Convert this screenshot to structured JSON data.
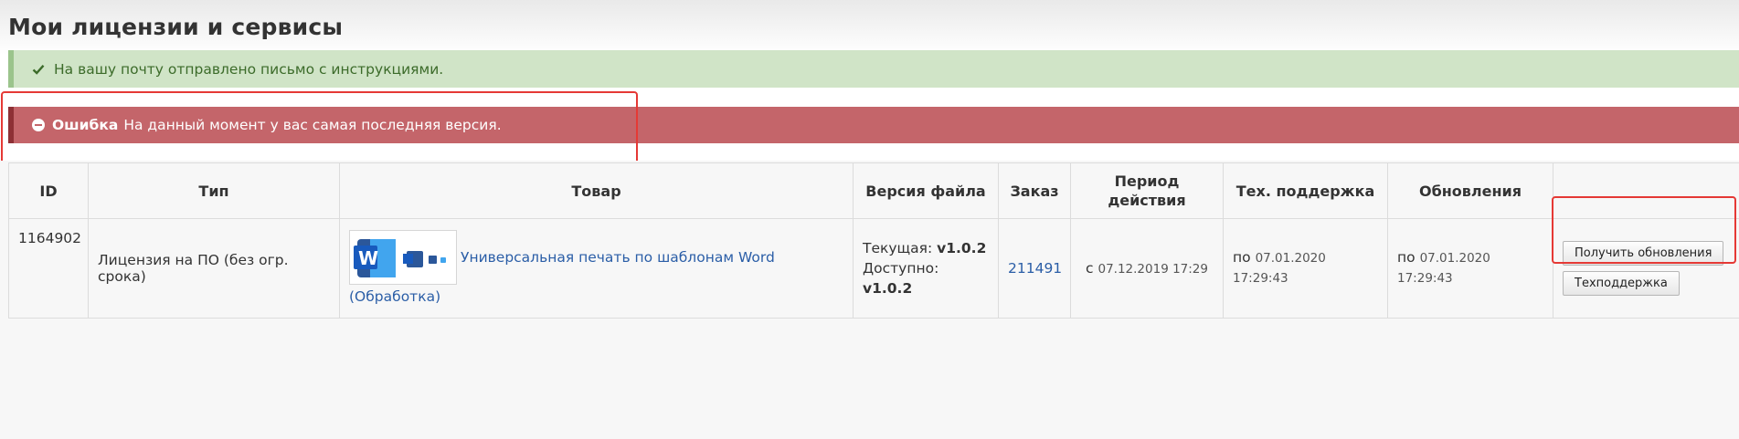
{
  "page": {
    "title": "Мои лицензии и сервисы"
  },
  "alerts": {
    "success": {
      "text": "На вашу почту отправлено письмо с инструкциями."
    },
    "error": {
      "label": "Ошибка",
      "text": "На данный момент у вас самая последняя версия."
    }
  },
  "table": {
    "headers": {
      "id": "ID",
      "type": "Тип",
      "product": "Товар",
      "file_version": "Версия файла",
      "order": "Заказ",
      "period_line1": "Период",
      "period_line2": "действия",
      "support": "Тех. поддержка",
      "updates": "Обновления"
    },
    "row": {
      "id": "1164902",
      "type": "Лицензия на ПО (без огр. срока)",
      "product_name": "Универсальная печать по шаблонам Word",
      "product_note": "(Обработка)",
      "current_label": "Текущая:",
      "current_version": "v1.0.2",
      "available_label": "Доступно:",
      "available_version": "v1.0.2",
      "order": "211491",
      "period_prefix": "с",
      "period_date": "07.12.2019 17:29",
      "support_prefix": "по",
      "support_date": "07.01.2020 17:29:43",
      "updates_prefix": "по",
      "updates_date": "07.01.2020 17:29:43",
      "btn_get_updates": "Получить обновления",
      "btn_support": "Техподдержка"
    }
  },
  "colors": {
    "success_bg": "#d0e4c7",
    "error_bg": "#c4656a",
    "link": "#2b5ea7",
    "highlight": "#e53935"
  },
  "icons": {
    "success": "check-icon",
    "error": "minus-circle-icon",
    "product": "word-app-icon"
  }
}
